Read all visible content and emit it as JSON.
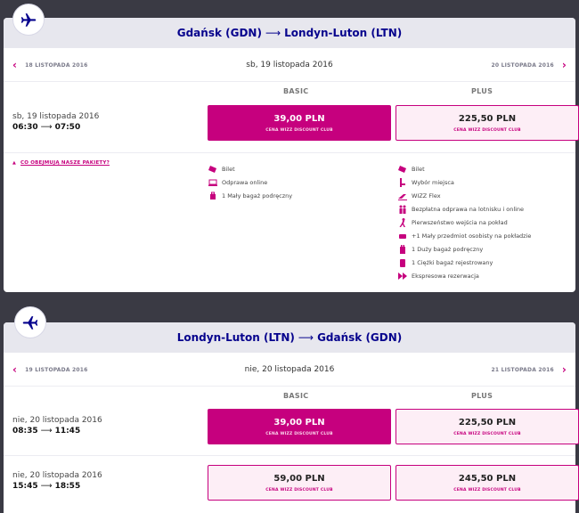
{
  "colors": {
    "brand": "#c6007e",
    "navy": "#06038d",
    "panel_bg": "#ffffff",
    "route_bg": "#e7e7ee"
  },
  "outbound": {
    "route": {
      "from": "Gdańsk (GDN)",
      "arrow": "⟶",
      "to": "Londyn-Luton (LTN)"
    },
    "nav": {
      "prev": "18 LISTOPADA 2016",
      "current": "sb, 19 listopada 2016",
      "next": "20 LISTOPADA 2016"
    },
    "fare_headers": {
      "basic": "BASIC",
      "plus": "PLUS"
    },
    "flights": [
      {
        "date": "sb, 19 listopada 2016",
        "depart": "06:30",
        "arrow": "⟶",
        "arrive": "07:50",
        "basic_price": "39,00 PLN",
        "basic_club": "CENA WIZZ DISCOUNT CLUB",
        "plus_price": "225,50 PLN",
        "plus_club": "CENA WIZZ DISCOUNT CLUB"
      }
    ],
    "packages_link": "CO OBEJMUJĄ NASZE PAKIETY?",
    "basic_features": [
      {
        "icon": "ticket-icon",
        "label": "Bilet"
      },
      {
        "icon": "online-checkin-icon",
        "label": "Odprawa online"
      },
      {
        "icon": "small-bag-icon",
        "label": "1 Mały bagaż podręczny"
      }
    ],
    "plus_features": [
      {
        "icon": "ticket-icon",
        "label": "Bilet"
      },
      {
        "icon": "seat-icon",
        "label": "Wybór miejsca"
      },
      {
        "icon": "wizz-flex-icon",
        "label": "WIZZ Flex"
      },
      {
        "icon": "checkin-people-icon",
        "label": "Bezpłatna odprawa na lotnisku i online"
      },
      {
        "icon": "priority-boarding-icon",
        "label": "Pierwszeństwo wejścia na pokład"
      },
      {
        "icon": "personal-item-icon",
        "label": "+1 Mały przedmiot osobisty na pokładzie"
      },
      {
        "icon": "large-cabin-bag-icon",
        "label": "1 Duży bagaż podręczny"
      },
      {
        "icon": "checked-bag-icon",
        "label": "1 Ciężki bagaż rejestrowany"
      },
      {
        "icon": "express-booking-icon",
        "label": "Ekspresowa rezerwacja"
      }
    ]
  },
  "inbound": {
    "route": {
      "from": "Londyn-Luton (LTN)",
      "arrow": "⟶",
      "to": "Gdańsk (GDN)"
    },
    "nav": {
      "prev": "19 LISTOPADA 2016",
      "current": "nie, 20 listopada 2016",
      "next": "21 LISTOPADA 2016"
    },
    "fare_headers": {
      "basic": "BASIC",
      "plus": "PLUS"
    },
    "flights": [
      {
        "date": "nie, 20 listopada 2016",
        "depart": "08:35",
        "arrow": "⟶",
        "arrive": "11:45",
        "basic_price": "39,00 PLN",
        "basic_club": "CENA WIZZ DISCOUNT CLUB",
        "plus_price": "225,50 PLN",
        "plus_club": "CENA WIZZ DISCOUNT CLUB"
      },
      {
        "date": "nie, 20 listopada 2016",
        "depart": "15:45",
        "arrow": "⟶",
        "arrive": "18:55",
        "basic_price": "59,00 PLN",
        "basic_club": "CENA WIZZ DISCOUNT CLUB",
        "plus_price": "245,50 PLN",
        "plus_club": "CENA WIZZ DISCOUNT CLUB"
      }
    ]
  }
}
